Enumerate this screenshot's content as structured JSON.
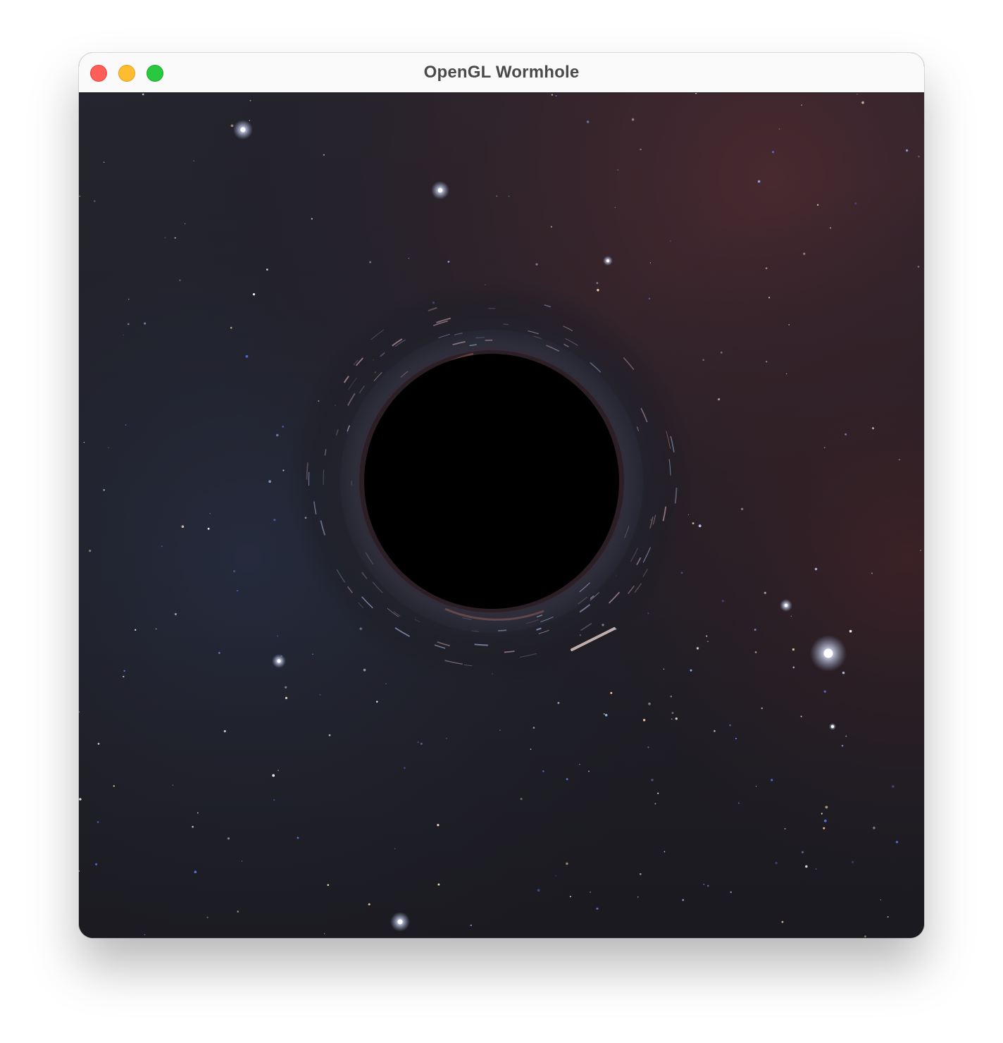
{
  "window": {
    "title": "OpenGL Wormhole",
    "buttons": {
      "close": "close-button",
      "minimize": "minimize-button",
      "zoom": "zoom-button"
    }
  },
  "scene": {
    "description_icons": [
      "starfield",
      "wormhole",
      "nebula"
    ],
    "colors": {
      "space_dark": "#1b1a21",
      "space_blue": "#252a3a",
      "nebula_red": "#4a2a2e",
      "wormhole_core": "#000000",
      "close": "#fe5f57",
      "minimize": "#febc2e",
      "zoom": "#28c840"
    }
  }
}
